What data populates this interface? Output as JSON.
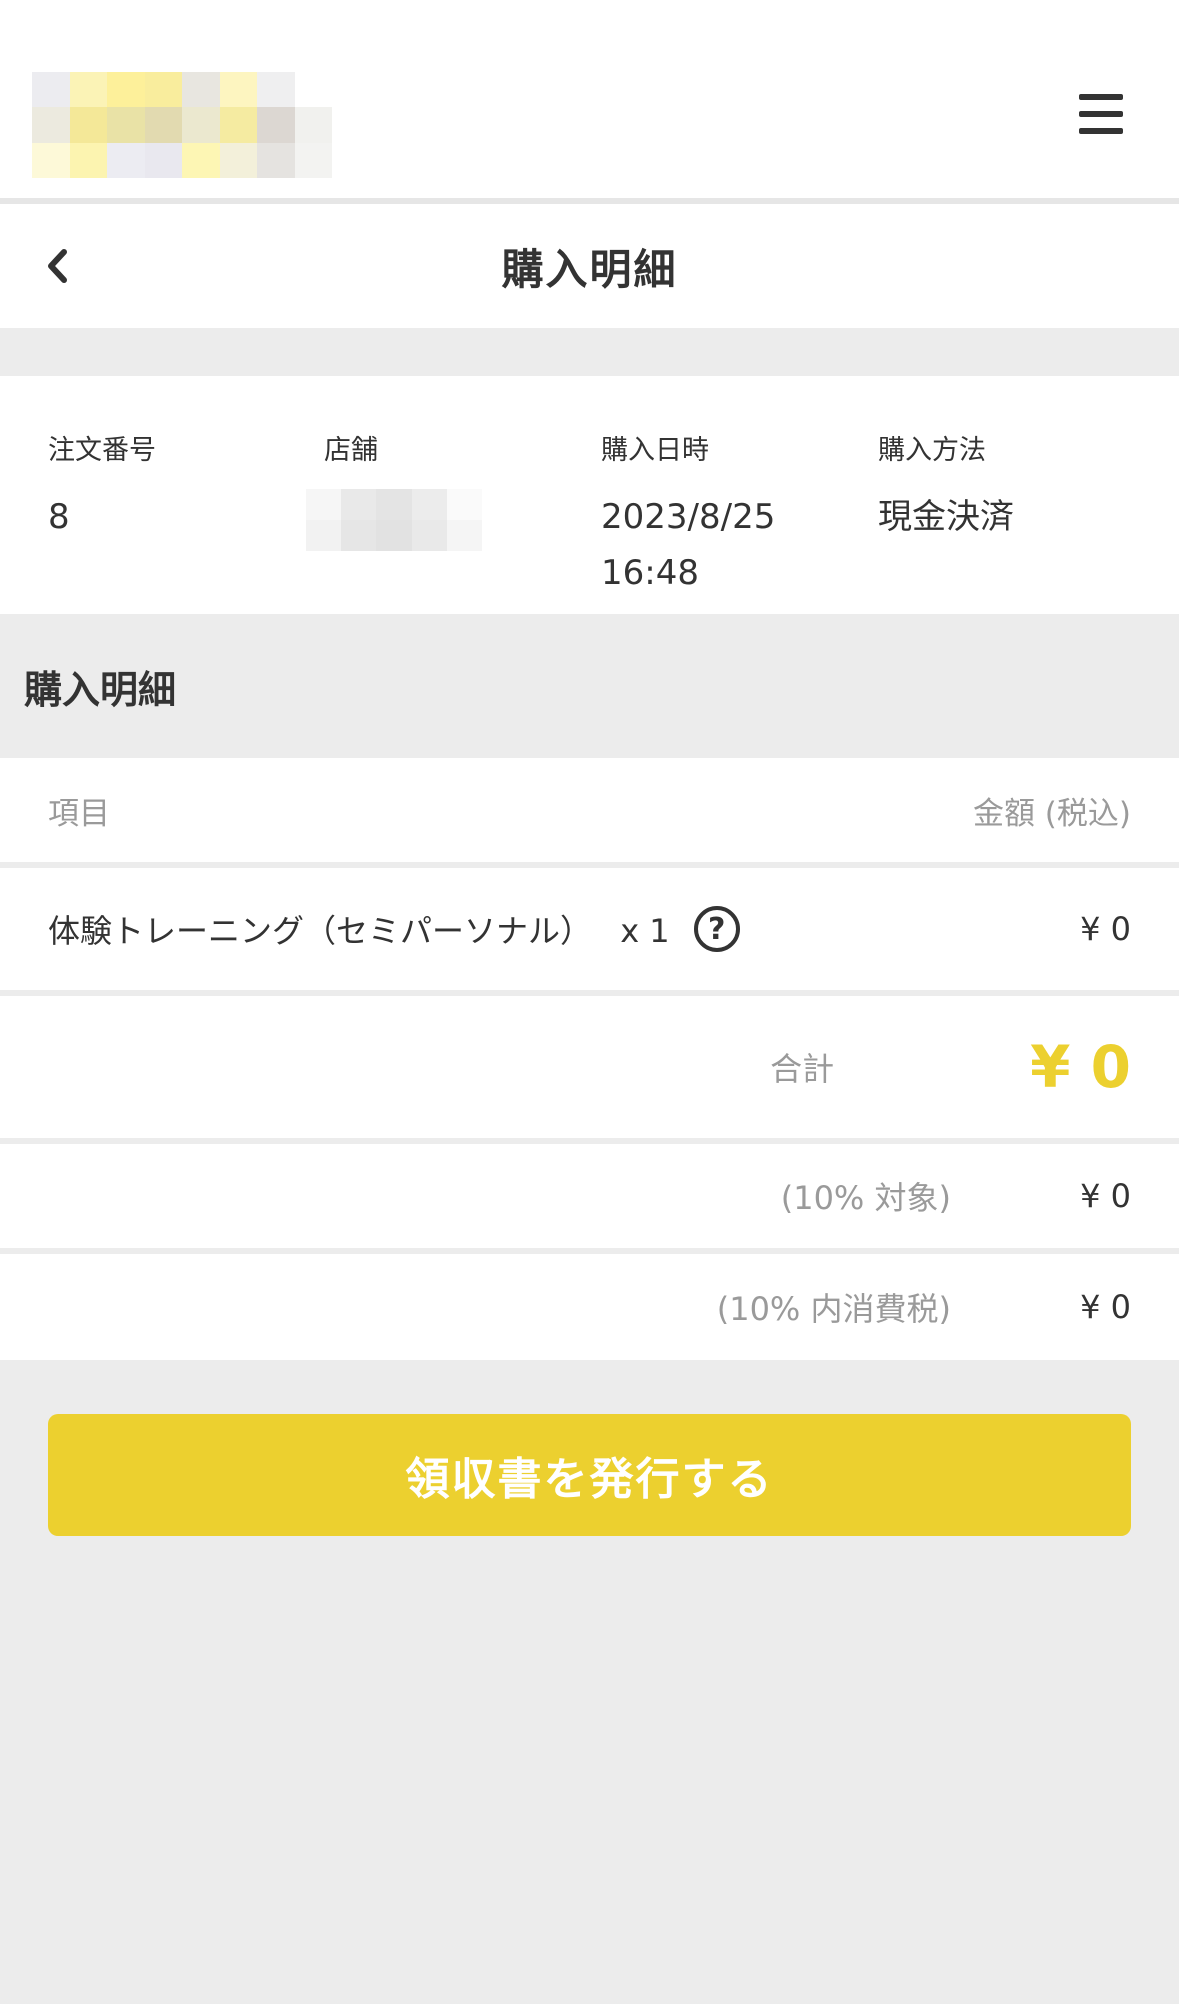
{
  "header": {
    "menu_icon": "hamburger-menu-icon",
    "logo_colors": [
      "#ececf0",
      "#fbf3b6",
      "#fdf09a",
      "#f9ed9d",
      "#e8e6e0",
      "#fdf5c0",
      "#efeff0",
      "#ffffff",
      "#eceadf",
      "#f4e898",
      "#e9e2a6",
      "#e2dab0",
      "#ebe8cf",
      "#f5eba1",
      "#dcd7d2",
      "#f1f1ee",
      "#fdf9d8",
      "#fcf4b0",
      "#ececf2",
      "#e9e8ef",
      "#fdf6b4",
      "#f3f0da",
      "#e5e3e0",
      "#f3f3f1"
    ]
  },
  "title_bar": {
    "title": "購入明細",
    "back_icon": "chevron-left-icon"
  },
  "order_info": {
    "order_number_label": "注文番号",
    "order_number": "8",
    "store_label": "店舗",
    "store_blur_colors": [
      "#f6f6f6",
      "#e9e9e9",
      "#e4e4e4",
      "#ececec",
      "#fafafa",
      "#f2f2f2",
      "#e6e6e6",
      "#e2e2e2",
      "#e9e9e9",
      "#f5f5f5"
    ],
    "date_label": "購入日時",
    "date": "2023/8/25",
    "time": "16:48",
    "method_label": "購入方法",
    "method": "現金決済"
  },
  "details": {
    "section_title": "購入明細",
    "col_item": "項目",
    "col_amount": "金額 (税込)",
    "items": [
      {
        "name": "体験トレーニング（セミパーソナル）",
        "qty": "x 1",
        "help_icon": "question-circle-icon",
        "price": "¥ 0"
      }
    ],
    "total_label": "合計",
    "total_value": "¥ 0",
    "tax_rows": [
      {
        "label": "(10% 対象)",
        "value": "¥ 0"
      },
      {
        "label": "(10% 内消費税)",
        "value": "¥ 0"
      }
    ]
  },
  "actions": {
    "issue_receipt": "領収書を発行する"
  },
  "colors": {
    "accent": "#ecd02f",
    "background": "#ececec",
    "muted_text": "#9a9a9a"
  }
}
